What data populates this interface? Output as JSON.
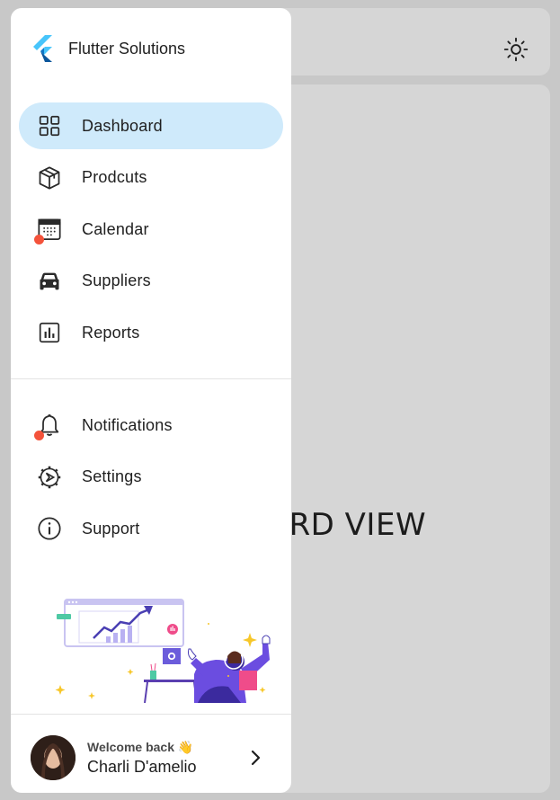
{
  "app": {
    "brand_name": "Flutter Solutions"
  },
  "main": {
    "title": "DASHBOARD VIEW"
  },
  "nav": {
    "primary": [
      {
        "label": "Dashboard",
        "icon": "grid-icon",
        "active": true
      },
      {
        "label": "Prodcuts",
        "icon": "box-icon"
      },
      {
        "label": "Calendar",
        "icon": "calendar-icon",
        "badge_dot": true
      },
      {
        "label": "Suppliers",
        "icon": "car-icon"
      },
      {
        "label": "Reports",
        "icon": "bar-chart-icon"
      }
    ],
    "secondary": [
      {
        "label": "Notifications",
        "icon": "bell-icon",
        "badge_dot": true
      },
      {
        "label": "Settings",
        "icon": "gear-icon"
      },
      {
        "label": "Support",
        "icon": "info-icon"
      }
    ]
  },
  "profile": {
    "welcome": "Welcome back 👋",
    "name": "Charli D'amelio"
  },
  "colors": {
    "active_bg": "#cfeafb",
    "badge": "#f4533b",
    "flutter_light": "#47c5fb",
    "flutter_dark": "#0b569b"
  }
}
